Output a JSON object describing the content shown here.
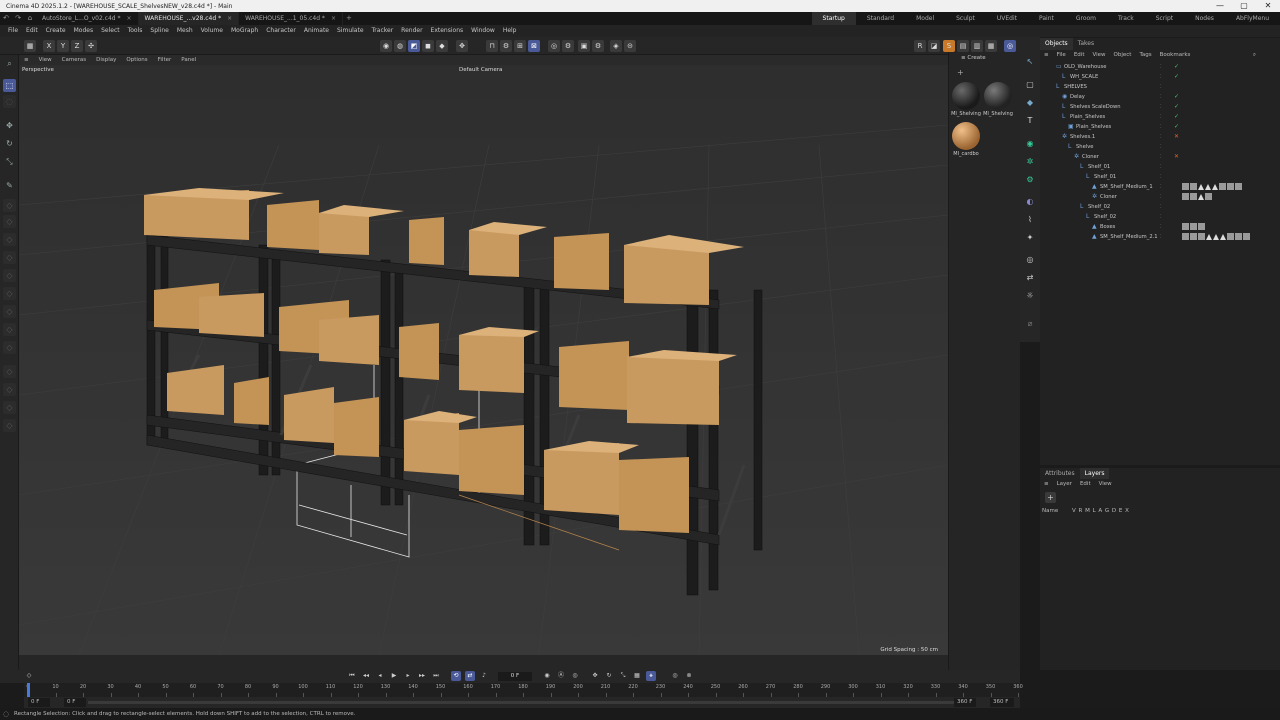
{
  "window": {
    "title": "Cinema 4D 2025.1.2 - [WAREHOUSE_SCALE_ShelvesNEW_v28.c4d *] - Main",
    "controls": [
      "—",
      "▢",
      "✕"
    ]
  },
  "doc_tabs": [
    {
      "label": "AutoStore_L...O_v02.c4d *",
      "active": false
    },
    {
      "label": "WAREHOUSE_...v28.c4d *",
      "active": true
    },
    {
      "label": "WAREHOUSE_...1_05.c4d *",
      "active": false
    }
  ],
  "layouts": [
    "Startup",
    "Standard",
    "Model",
    "Sculpt",
    "UVEdit",
    "Paint",
    "Groom",
    "Track",
    "Script",
    "Nodes",
    "AbFlyMenu"
  ],
  "active_layout": "Startup",
  "menu": [
    "File",
    "Edit",
    "Create",
    "Modes",
    "Select",
    "Tools",
    "Spline",
    "Mesh",
    "Volume",
    "MoGraph",
    "Character",
    "Animate",
    "Simulate",
    "Tracker",
    "Render",
    "Extensions",
    "Window",
    "Help"
  ],
  "toolbar": {
    "axis_labels": [
      "X",
      "Y",
      "Z"
    ]
  },
  "viewport": {
    "menu": [
      "View",
      "Cameras",
      "Display",
      "Options",
      "Filter",
      "Panel"
    ],
    "label": "Perspective",
    "camera": "Default Camera",
    "grid_spacing": "Grid Spacing : 50 cm"
  },
  "materials": {
    "menu_label": "Create",
    "items": [
      {
        "label": "MI_Shelving",
        "color": "#2a2a2a"
      },
      {
        "label": "MI_Shelving",
        "color": "#3a3a3a"
      },
      {
        "label": "MI_cardbo",
        "color": "#c9894e"
      }
    ]
  },
  "object_manager": {
    "tabs": [
      "Objects",
      "Takes"
    ],
    "active_tab": "Objects",
    "menu": [
      "File",
      "Edit",
      "View",
      "Object",
      "Tags",
      "Bookmarks"
    ],
    "rows": [
      {
        "name": "OLD_Warehouse",
        "depth": 0,
        "icon": "▭",
        "check": "✓"
      },
      {
        "name": "WH_SCALE",
        "depth": 1,
        "icon": "L",
        "check": "✓"
      },
      {
        "name": "SHELVES",
        "depth": 0,
        "icon": "L",
        "check": ""
      },
      {
        "name": "Delay",
        "depth": 1,
        "icon": "◉",
        "check": "✓"
      },
      {
        "name": "Shelves ScaleDown",
        "depth": 1,
        "icon": "L",
        "check": "✓"
      },
      {
        "name": "Plain_Shelves",
        "depth": 1,
        "icon": "L",
        "check": "✓"
      },
      {
        "name": "Plain_Shelves",
        "depth": 2,
        "icon": "▣",
        "check": "✓"
      },
      {
        "name": "Shelves.1",
        "depth": 1,
        "icon": "✲",
        "check": "✕"
      },
      {
        "name": "Shelve",
        "depth": 2,
        "icon": "L",
        "check": ""
      },
      {
        "name": "Cloner",
        "depth": 3,
        "icon": "✲",
        "check": "✕"
      },
      {
        "name": "Shelf_01",
        "depth": 4,
        "icon": "L",
        "check": ""
      },
      {
        "name": "Shelf_01",
        "depth": 5,
        "icon": "L",
        "check": ""
      },
      {
        "name": "SM_Shelf_Medium_1",
        "depth": 6,
        "icon": "▲",
        "check": "",
        "tags": [
          "s",
          "s",
          "t",
          "t",
          "t",
          "s",
          "s",
          "s"
        ]
      },
      {
        "name": "Cloner",
        "depth": 6,
        "icon": "✲",
        "check": "",
        "tags": [
          "s",
          "s",
          "t",
          "s"
        ]
      },
      {
        "name": "Shelf_02",
        "depth": 4,
        "icon": "L",
        "check": ""
      },
      {
        "name": "Shelf_02",
        "depth": 5,
        "icon": "L",
        "check": ""
      },
      {
        "name": "Boxes",
        "depth": 6,
        "icon": "▲",
        "check": "",
        "tags": [
          "s",
          "s",
          "s"
        ]
      },
      {
        "name": "SM_Shelf_Medium_2.1",
        "depth": 6,
        "icon": "▲",
        "check": "",
        "tags": [
          "s",
          "s",
          "s",
          "t",
          "t",
          "t",
          "s",
          "s",
          "s"
        ]
      }
    ]
  },
  "layers": {
    "tabs": [
      "Attributes",
      "Layers"
    ],
    "active_tab": "Layers",
    "menu": [
      "Layer",
      "Edit",
      "View"
    ],
    "name_header": "Name",
    "flags": "V R M L A G D E X"
  },
  "timeline": {
    "ticks": [
      "0",
      "10",
      "20",
      "30",
      "40",
      "50",
      "60",
      "70",
      "80",
      "90",
      "100",
      "110",
      "120",
      "130",
      "140",
      "150",
      "160",
      "170",
      "180",
      "190",
      "200",
      "210",
      "220",
      "230",
      "240",
      "250",
      "260",
      "270",
      "280",
      "290",
      "300",
      "310",
      "320",
      "330",
      "340",
      "350",
      "360"
    ],
    "current_frame": "0 F",
    "start": "0 F",
    "min": "0 F",
    "end": "360 F",
    "max": "360 F"
  },
  "status": "Rectangle Selection: Click and drag to rectangle-select elements. Hold down SHIFT to add to the selection, CTRL to remove."
}
